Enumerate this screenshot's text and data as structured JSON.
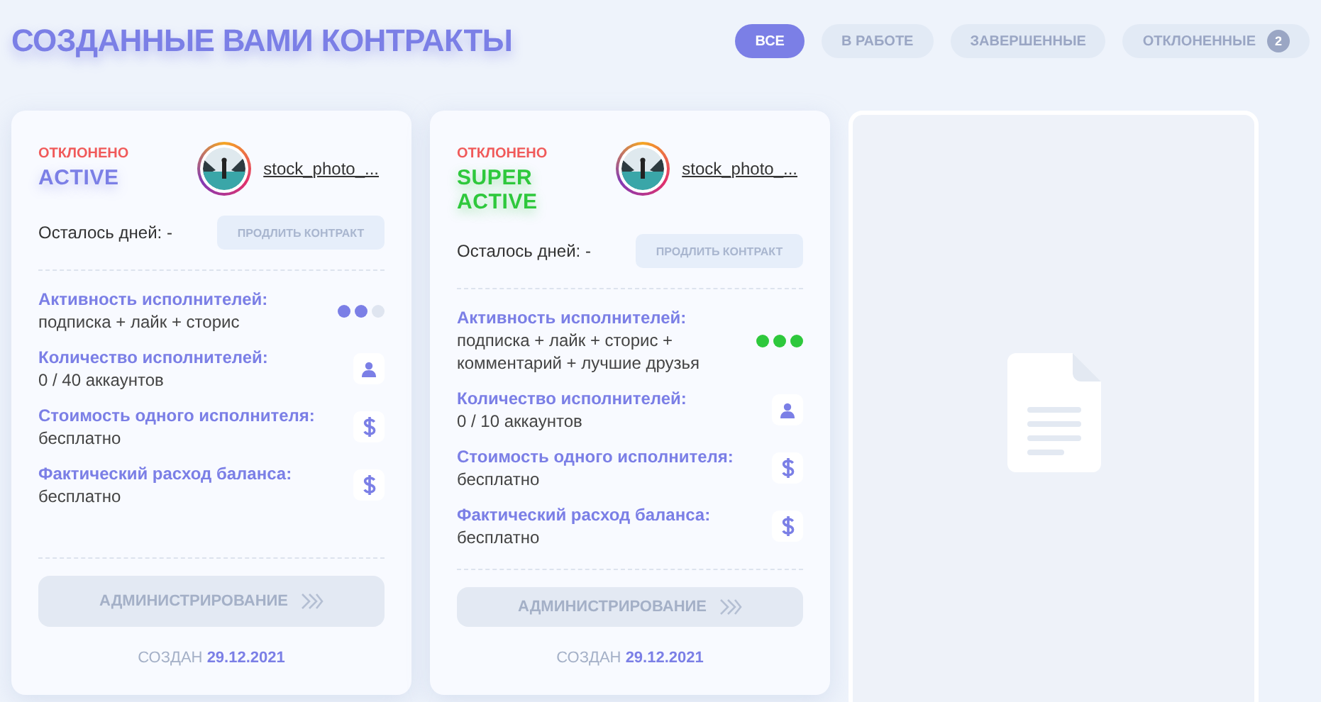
{
  "page_title": "СОЗДАННЫЕ ВАМИ КОНТРАКТЫ",
  "filters": [
    {
      "label": "ВСЕ",
      "selected": true
    },
    {
      "label": "В РАБОТЕ",
      "selected": false
    },
    {
      "label": "ЗАВЕРШЕННЫЕ",
      "selected": false
    },
    {
      "label": "ОТКЛОНЕННЫЕ",
      "selected": false,
      "badge": "2"
    }
  ],
  "contracts": [
    {
      "status": "ОТКЛОНЕНО",
      "tariff": "ACTIVE",
      "color": "#7b7fe6",
      "username": "stock_photo_...",
      "days_left": "Осталось дней: -",
      "extend_button": "ПРОДЛИТЬ КОНТРАКТ",
      "details": [
        {
          "kind": "dots",
          "label": "Активность исполнителей:",
          "value": "подписка + лайк + сторис",
          "stars": 2
        },
        {
          "kind": "person",
          "label": "Количество исполнителей:",
          "value": "0 / 40 аккаунтов"
        },
        {
          "kind": "dollar",
          "label": "Стоимость одного исполнителя:",
          "value": "бесплатно"
        },
        {
          "kind": "dollar",
          "label": "Фактический расход баланса:",
          "value": "бесплатно"
        }
      ],
      "admin_button": "АДМИНИСТРИРОВАНИЕ",
      "created": "СОЗДАН **29.12.2021**"
    },
    {
      "status": "ОТКЛОНЕНО",
      "tariff": "SUPER ACTIVE",
      "color": "#2ec83c",
      "username": "stock_photo_...",
      "days_left": "Осталось дней: -",
      "extend_button": "ПРОДЛИТЬ КОНТРАКТ",
      "details": [
        {
          "kind": "dots",
          "label": "Активность исполнителей:",
          "value": "подписка + лайк + сторис + комментарий + лучшие друзья",
          "stars": 3
        },
        {
          "kind": "person",
          "label": "Количество исполнителей:",
          "value": "0 / 10 аккаунтов"
        },
        {
          "kind": "dollar",
          "label": "Стоимость одного исполнителя:",
          "value": "бесплатно"
        },
        {
          "kind": "dollar",
          "label": "Фактический расход баланса:",
          "value": "бесплатно"
        }
      ],
      "admin_button": "АДМИНИСТРИРОВАНИЕ",
      "created": "СОЗДАН **29.12.2021**"
    }
  ],
  "placeholder_card": {
    "kind": "empty"
  }
}
